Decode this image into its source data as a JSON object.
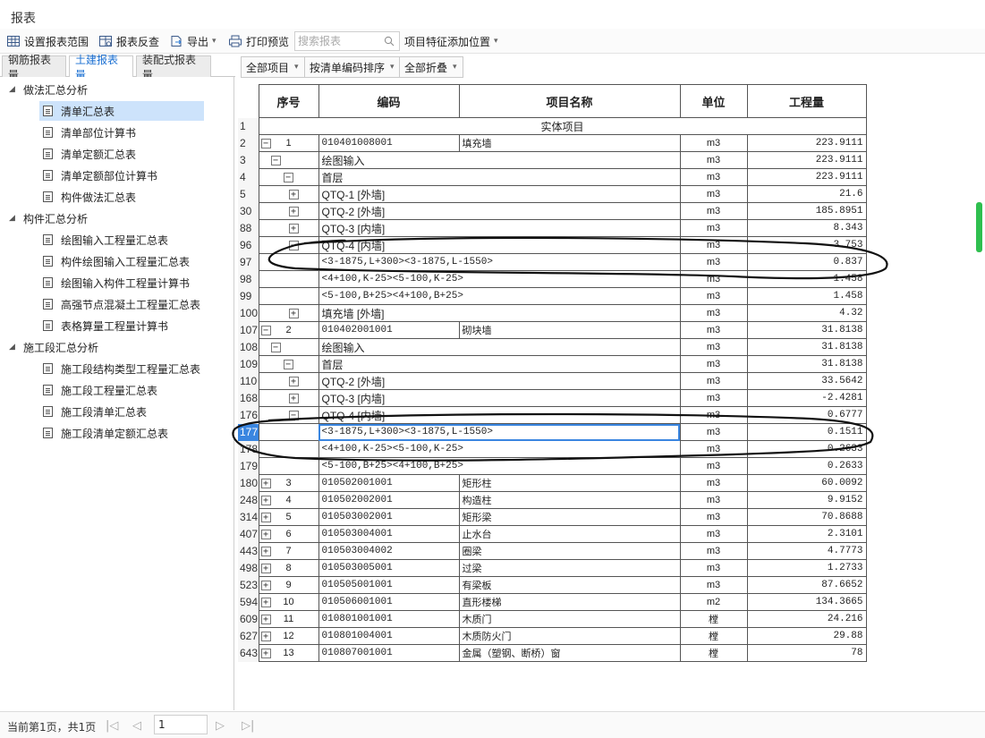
{
  "window": {
    "title": "报表"
  },
  "toolbar": {
    "set_range": "设置报表范围",
    "reverse_check": "报表反查",
    "export": "导出",
    "print_preview": "打印预览",
    "search_placeholder": "搜索报表",
    "feature_position": "项目特征添加位置"
  },
  "tabs": [
    {
      "label": "钢筋报表量",
      "active": false
    },
    {
      "label": "土建报表量",
      "active": true
    },
    {
      "label": "装配式报表量",
      "active": false
    }
  ],
  "tree": {
    "groups": [
      {
        "label": "做法汇总分析",
        "items": [
          "清单汇总表",
          "清单部位计算书",
          "清单定额汇总表",
          "清单定额部位计算书",
          "构件做法汇总表"
        ]
      },
      {
        "label": "构件汇总分析",
        "items": [
          "绘图输入工程量汇总表",
          "构件绘图输入工程量汇总表",
          "绘图输入构件工程量计算书",
          "高强节点混凝土工程量汇总表",
          "表格算量工程量计算书"
        ]
      },
      {
        "label": "施工段汇总分析",
        "items": [
          "施工段结构类型工程量汇总表",
          "施工段工程量汇总表",
          "施工段清单汇总表",
          "施工段清单定额汇总表"
        ]
      }
    ],
    "selected": "清单汇总表"
  },
  "filters": {
    "all_items": "全部项目",
    "sort": "按清单编码排序",
    "collapse": "全部折叠"
  },
  "grid": {
    "headers": {
      "seq": "序号",
      "code": "编码",
      "name": "项目名称",
      "unit": "单位",
      "qty": "工程量"
    },
    "section_title": "实体项目",
    "rows": [
      {
        "rn": "1",
        "kind": "section"
      },
      {
        "rn": "2",
        "toggle": "−",
        "seq": "1",
        "code": "010401008001",
        "name": "填充墙",
        "unit": "m3",
        "qty": "223.9111"
      },
      {
        "rn": "3",
        "toggle": "−",
        "lvl": 1,
        "code": "绘图输入",
        "unit": "m3",
        "qty": "223.9111"
      },
      {
        "rn": "4",
        "toggle": "−",
        "lvl": 2,
        "code": "首层",
        "unit": "m3",
        "qty": "223.9111"
      },
      {
        "rn": "5",
        "toggle": "+",
        "lvl": 3,
        "code": "QTQ-1 [外墙]",
        "unit": "m3",
        "qty": "21.6"
      },
      {
        "rn": "30",
        "toggle": "+",
        "lvl": 3,
        "code": "QTQ-2 [外墙]",
        "unit": "m3",
        "qty": "185.8951"
      },
      {
        "rn": "88",
        "toggle": "+",
        "lvl": 3,
        "code": "QTQ-3 [内墙]",
        "unit": "m3",
        "qty": "8.343"
      },
      {
        "rn": "96",
        "toggle": "−",
        "lvl": 3,
        "code": "QTQ-4 [内墙]",
        "unit": "m3",
        "qty": "3.753"
      },
      {
        "rn": "97",
        "lvl": 4,
        "code": "<3-1875,L+300><3-1875,L-1550>",
        "unit": "m3",
        "qty": "0.837"
      },
      {
        "rn": "98",
        "lvl": 4,
        "code": "<4+100,K-25><5-100,K-25>",
        "unit": "m3",
        "qty": "1.458"
      },
      {
        "rn": "99",
        "lvl": 4,
        "code": "<5-100,B+25><4+100,B+25>",
        "unit": "m3",
        "qty": "1.458"
      },
      {
        "rn": "100",
        "toggle": "+",
        "lvl": 3,
        "code": "填充墙 [外墙]",
        "unit": "m3",
        "qty": "4.32"
      },
      {
        "rn": "107",
        "toggle": "−",
        "seq": "2",
        "code": "010402001001",
        "name": "砌块墙",
        "unit": "m3",
        "qty": "31.8138"
      },
      {
        "rn": "108",
        "toggle": "−",
        "lvl": 1,
        "code": "绘图输入",
        "unit": "m3",
        "qty": "31.8138"
      },
      {
        "rn": "109",
        "toggle": "−",
        "lvl": 2,
        "code": "首层",
        "unit": "m3",
        "qty": "31.8138"
      },
      {
        "rn": "110",
        "toggle": "+",
        "lvl": 3,
        "code": "QTQ-2 [外墙]",
        "unit": "m3",
        "qty": "33.5642"
      },
      {
        "rn": "168",
        "toggle": "+",
        "lvl": 3,
        "code": "QTQ-3 [内墙]",
        "unit": "m3",
        "qty": "-2.4281"
      },
      {
        "rn": "176",
        "toggle": "−",
        "lvl": 3,
        "code": "QTQ-4 [内墙]",
        "unit": "m3",
        "qty": "0.6777"
      },
      {
        "rn": "177",
        "lvl": 4,
        "code": "<3-1875,L+300><3-1875,L-1550>",
        "unit": "m3",
        "qty": "0.1511",
        "selected": true
      },
      {
        "rn": "178",
        "lvl": 4,
        "code": "<4+100,K-25><5-100,K-25>",
        "unit": "m3",
        "qty": "0.2633"
      },
      {
        "rn": "179",
        "lvl": 4,
        "code": "<5-100,B+25><4+100,B+25>",
        "unit": "m3",
        "qty": "0.2633"
      },
      {
        "rn": "180",
        "toggle": "+",
        "seq": "3",
        "code": "010502001001",
        "name": "矩形柱",
        "unit": "m3",
        "qty": "60.0092"
      },
      {
        "rn": "248",
        "toggle": "+",
        "seq": "4",
        "code": "010502002001",
        "name": "构造柱",
        "unit": "m3",
        "qty": "9.9152"
      },
      {
        "rn": "314",
        "toggle": "+",
        "seq": "5",
        "code": "010503002001",
        "name": "矩形梁",
        "unit": "m3",
        "qty": "70.8688"
      },
      {
        "rn": "407",
        "toggle": "+",
        "seq": "6",
        "code": "010503004001",
        "name": "止水台",
        "unit": "m3",
        "qty": "2.3101"
      },
      {
        "rn": "443",
        "toggle": "+",
        "seq": "7",
        "code": "010503004002",
        "name": "圈梁",
        "unit": "m3",
        "qty": "4.7773"
      },
      {
        "rn": "498",
        "toggle": "+",
        "seq": "8",
        "code": "010503005001",
        "name": "过梁",
        "unit": "m3",
        "qty": "1.2733"
      },
      {
        "rn": "523",
        "toggle": "+",
        "seq": "9",
        "code": "010505001001",
        "name": "有梁板",
        "unit": "m3",
        "qty": "87.6652"
      },
      {
        "rn": "594",
        "toggle": "+",
        "seq": "10",
        "code": "010506001001",
        "name": "直形楼梯",
        "unit": "m2",
        "qty": "134.3665"
      },
      {
        "rn": "609",
        "toggle": "+",
        "seq": "11",
        "code": "010801001001",
        "name": "木质门",
        "unit": "樘",
        "qty": "24.216"
      },
      {
        "rn": "627",
        "toggle": "+",
        "seq": "12",
        "code": "010801004001",
        "name": "木质防火门",
        "unit": "樘",
        "qty": "29.88"
      },
      {
        "rn": "643",
        "toggle": "+",
        "seq": "13",
        "code": "010807001001",
        "name": "金属（塑钢、断桥）窗",
        "unit": "樘",
        "qty": "78"
      }
    ]
  },
  "status": {
    "page_text": "当前第1页，共1页",
    "page_input": "1"
  },
  "icons": [
    "range-icon",
    "reverse-check-icon",
    "export-icon",
    "print-preview-icon",
    "search-icon",
    "document-icon",
    "first-page-icon",
    "prev-page-icon",
    "next-page-icon",
    "last-page-icon"
  ],
  "colors": {
    "tab_active_text": "#1a6fd2",
    "selection": "#cde3fb",
    "selected_cell_border": "#3a86e0",
    "annotation_ink": "#111111"
  }
}
